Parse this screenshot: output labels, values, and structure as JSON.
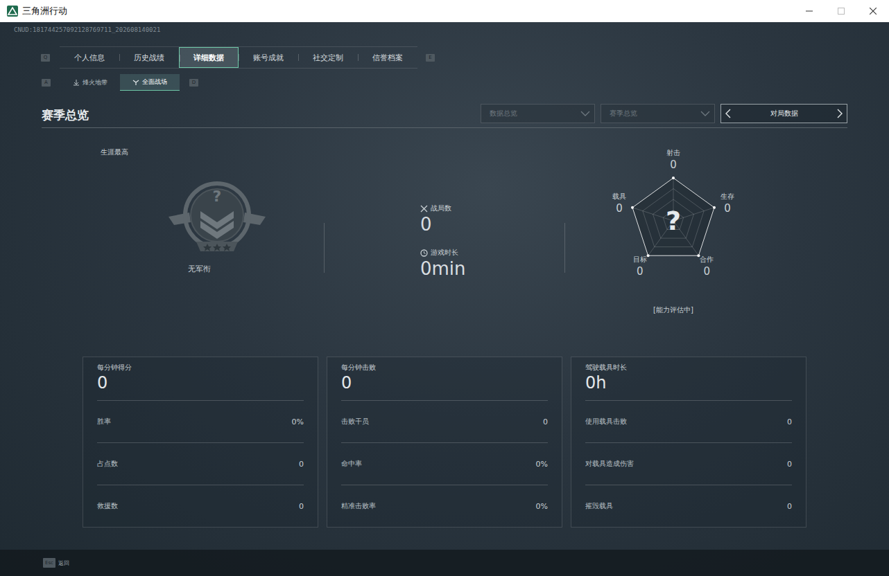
{
  "window": {
    "title": "三角洲行动"
  },
  "uid": "CNUD:181744257092128769711_202608140021",
  "tabs": {
    "prev_key": "Q",
    "next_key": "E",
    "items": [
      {
        "label": "个人信息",
        "selected": false
      },
      {
        "label": "历史战绩",
        "selected": false
      },
      {
        "label": "详细数据",
        "selected": true
      },
      {
        "label": "账号成就",
        "selected": false
      },
      {
        "label": "社交定制",
        "selected": false
      },
      {
        "label": "信誉档案",
        "selected": false
      }
    ]
  },
  "subtabs": {
    "prev_key": "A",
    "next_key": "D",
    "items": [
      {
        "label": "烽火地带",
        "selected": false
      },
      {
        "label": "全面战场",
        "selected": true
      }
    ]
  },
  "section": {
    "title": "赛季总览",
    "filters": [
      {
        "label": "数据总览",
        "disabled": true
      },
      {
        "label": "赛季总览",
        "disabled": true
      }
    ],
    "switcher": {
      "label": "对局数据"
    }
  },
  "rank": {
    "caption": "生涯最高",
    "badge": "?",
    "title": "无军衔"
  },
  "summary": [
    {
      "label": "战局数",
      "value": "0"
    },
    {
      "label": "游戏时长",
      "value": "0min"
    }
  ],
  "radar": {
    "center": "?",
    "status": "[能力评估中]",
    "axes": [
      {
        "label": "射击",
        "value": "0"
      },
      {
        "label": "生存",
        "value": "0"
      },
      {
        "label": "合作",
        "value": "0"
      },
      {
        "label": "目标",
        "value": "0"
      },
      {
        "label": "载具",
        "value": "0"
      }
    ]
  },
  "cards": [
    {
      "title": "每分钟得分",
      "value": "0",
      "rows": [
        {
          "label": "胜率",
          "value": "0%"
        },
        {
          "label": "占点数",
          "value": "0"
        },
        {
          "label": "救援数",
          "value": "0"
        }
      ]
    },
    {
      "title": "每分钟击败",
      "value": "0",
      "rows": [
        {
          "label": "击败干员",
          "value": "0"
        },
        {
          "label": "命中率",
          "value": "0%"
        },
        {
          "label": "精准击败率",
          "value": "0%"
        }
      ]
    },
    {
      "title": "驾驶载具时长",
      "value": "0h",
      "rows": [
        {
          "label": "使用载具击败",
          "value": "0"
        },
        {
          "label": "对载具造成伤害",
          "value": "0"
        },
        {
          "label": "摧毁载具",
          "value": "0"
        }
      ]
    }
  ],
  "footer": {
    "key": "Esc",
    "label": "返回"
  }
}
